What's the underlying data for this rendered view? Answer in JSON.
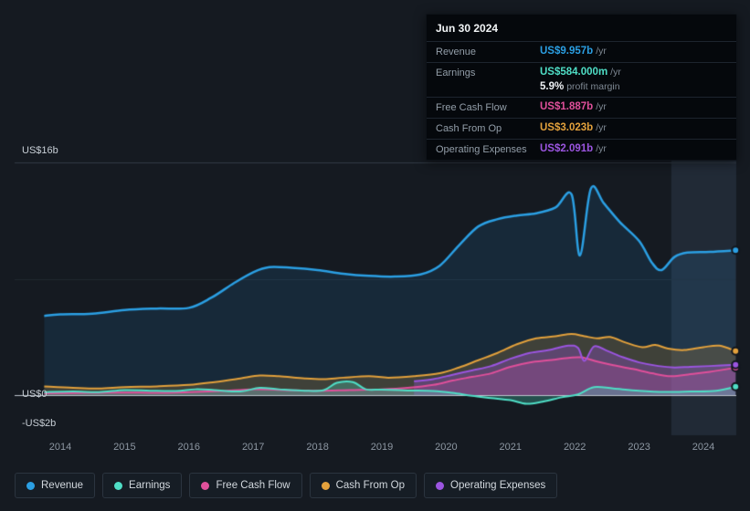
{
  "colors": {
    "background": "#151a21",
    "band": "#212a36",
    "grid": "#323b46",
    "grid_faint": "#202831",
    "zero_line": "#bcc4cd",
    "axis_text": "#8d97a2",
    "y_axis_text": "#c7ced5"
  },
  "tooltip": {
    "date": "Jun 30 2024",
    "rows": [
      {
        "id": "revenue",
        "label": "Revenue",
        "value": "US$9.957b",
        "suffix": "/yr",
        "color": "#2b9fe3"
      },
      {
        "id": "earnings",
        "label": "Earnings",
        "value": "US$584.000m",
        "suffix": "/yr",
        "color": "#4fdec6",
        "sub_value": "5.9%",
        "sub_suffix": "profit margin"
      },
      {
        "id": "free-cash-flow",
        "label": "Free Cash Flow",
        "value": "US$1.887b",
        "suffix": "/yr",
        "color": "#e0509b"
      },
      {
        "id": "cash-from-op",
        "label": "Cash From Op",
        "value": "US$3.023b",
        "suffix": "/yr",
        "color": "#e3a13c"
      },
      {
        "id": "operating-expenses",
        "label": "Operating Expenses",
        "value": "US$2.091b",
        "suffix": "/yr",
        "color": "#9b55e0"
      }
    ]
  },
  "axis": {
    "y_ticks": [
      {
        "label": "US$16b",
        "value": 16
      },
      {
        "label": "US$0",
        "value": 0
      },
      {
        "label": "-US$2b",
        "value": -2
      }
    ],
    "x_labels": [
      "2014",
      "2015",
      "2016",
      "2017",
      "2018",
      "2019",
      "2020",
      "2021",
      "2022",
      "2023",
      "2024"
    ]
  },
  "legend": [
    {
      "id": "revenue",
      "label": "Revenue",
      "color": "#2b9fe3"
    },
    {
      "id": "earnings",
      "label": "Earnings",
      "color": "#4fdec6"
    },
    {
      "id": "free-cash-flow",
      "label": "Free Cash Flow",
      "color": "#e0509b"
    },
    {
      "id": "cash-from-op",
      "label": "Cash From Op",
      "color": "#e3a13c"
    },
    {
      "id": "operating-expenses",
      "label": "Operating Expenses",
      "color": "#9b55e0"
    }
  ],
  "chart_data": {
    "type": "area",
    "unit": "US$ billions per year",
    "ylim": [
      -2,
      16
    ],
    "x_ticks": [
      2014,
      2015,
      2016,
      2017,
      2018,
      2019,
      2020,
      2021,
      2022,
      2023,
      2024
    ],
    "grid_values": [
      16,
      8
    ],
    "highlight_band": {
      "start_year": 2023.5,
      "end_year": 2024.6
    },
    "series": [
      {
        "name": "Revenue",
        "color": "#2b9fe3",
        "fill_alpha": 0.12,
        "line_width": 2.5,
        "points": [
          [
            2013.75,
            5.45
          ],
          [
            2014,
            5.55
          ],
          [
            2014.5,
            5.6
          ],
          [
            2015,
            5.85
          ],
          [
            2015.5,
            5.95
          ],
          [
            2016,
            6.0
          ],
          [
            2016.35,
            6.7
          ],
          [
            2016.7,
            7.7
          ],
          [
            2017,
            8.45
          ],
          [
            2017.25,
            8.8
          ],
          [
            2017.6,
            8.75
          ],
          [
            2018,
            8.6
          ],
          [
            2018.4,
            8.35
          ],
          [
            2018.8,
            8.2
          ],
          [
            2019.2,
            8.15
          ],
          [
            2019.6,
            8.3
          ],
          [
            2019.9,
            8.9
          ],
          [
            2020.2,
            10.3
          ],
          [
            2020.5,
            11.6
          ],
          [
            2020.8,
            12.1
          ],
          [
            2021.1,
            12.35
          ],
          [
            2021.4,
            12.5
          ],
          [
            2021.7,
            12.9
          ],
          [
            2021.95,
            13.8
          ],
          [
            2022.08,
            9.6
          ],
          [
            2022.25,
            14.2
          ],
          [
            2022.45,
            13.2
          ],
          [
            2022.7,
            11.9
          ],
          [
            2023,
            10.6
          ],
          [
            2023.2,
            9.1
          ],
          [
            2023.35,
            8.6
          ],
          [
            2023.55,
            9.5
          ],
          [
            2023.75,
            9.8
          ],
          [
            2024.1,
            9.85
          ],
          [
            2024.5,
            9.957
          ]
        ]
      },
      {
        "name": "Cash From Op",
        "color": "#e3a13c",
        "fill_alpha": 0.2,
        "line_width": 2,
        "points": [
          [
            2013.75,
            0.6
          ],
          [
            2014.2,
            0.5
          ],
          [
            2014.6,
            0.45
          ],
          [
            2015,
            0.55
          ],
          [
            2015.5,
            0.6
          ],
          [
            2016,
            0.7
          ],
          [
            2016.4,
            0.9
          ],
          [
            2016.8,
            1.15
          ],
          [
            2017.1,
            1.35
          ],
          [
            2017.4,
            1.3
          ],
          [
            2017.8,
            1.15
          ],
          [
            2018.1,
            1.1
          ],
          [
            2018.4,
            1.2
          ],
          [
            2018.8,
            1.3
          ],
          [
            2019.1,
            1.2
          ],
          [
            2019.5,
            1.3
          ],
          [
            2019.9,
            1.5
          ],
          [
            2020.2,
            1.9
          ],
          [
            2020.5,
            2.4
          ],
          [
            2020.8,
            2.9
          ],
          [
            2021.1,
            3.5
          ],
          [
            2021.4,
            3.9
          ],
          [
            2021.7,
            4.05
          ],
          [
            2021.95,
            4.2
          ],
          [
            2022.15,
            4.05
          ],
          [
            2022.35,
            3.9
          ],
          [
            2022.55,
            4.0
          ],
          [
            2022.8,
            3.6
          ],
          [
            2023.05,
            3.3
          ],
          [
            2023.25,
            3.45
          ],
          [
            2023.45,
            3.2
          ],
          [
            2023.7,
            3.1
          ],
          [
            2024,
            3.3
          ],
          [
            2024.25,
            3.4
          ],
          [
            2024.5,
            3.023
          ]
        ]
      },
      {
        "name": "Free Cash Flow",
        "color": "#e0509b",
        "fill_alpha": 0.22,
        "line_width": 2,
        "points": [
          [
            2013.75,
            0.12
          ],
          [
            2014.5,
            0.15
          ],
          [
            2015,
            0.18
          ],
          [
            2015.5,
            0.15
          ],
          [
            2016,
            0.2
          ],
          [
            2016.5,
            0.28
          ],
          [
            2017,
            0.4
          ],
          [
            2017.5,
            0.35
          ],
          [
            2018,
            0.3
          ],
          [
            2018.5,
            0.35
          ],
          [
            2019,
            0.4
          ],
          [
            2019.4,
            0.5
          ],
          [
            2019.8,
            0.7
          ],
          [
            2020.1,
            1.0
          ],
          [
            2020.4,
            1.25
          ],
          [
            2020.7,
            1.5
          ],
          [
            2021,
            1.95
          ],
          [
            2021.3,
            2.25
          ],
          [
            2021.6,
            2.4
          ],
          [
            2021.9,
            2.55
          ],
          [
            2022.1,
            2.6
          ],
          [
            2022.35,
            2.3
          ],
          [
            2022.6,
            2.05
          ],
          [
            2022.9,
            1.8
          ],
          [
            2023.2,
            1.5
          ],
          [
            2023.5,
            1.3
          ],
          [
            2023.8,
            1.45
          ],
          [
            2024.1,
            1.6
          ],
          [
            2024.5,
            1.887
          ]
        ]
      },
      {
        "name": "Operating Expenses",
        "color": "#9b55e0",
        "fill_alpha": 0.32,
        "line_width": 2,
        "points": [
          [
            2019.5,
            0.95
          ],
          [
            2019.8,
            1.1
          ],
          [
            2020.1,
            1.4
          ],
          [
            2020.4,
            1.7
          ],
          [
            2020.7,
            2.0
          ],
          [
            2021,
            2.5
          ],
          [
            2021.3,
            2.9
          ],
          [
            2021.6,
            3.1
          ],
          [
            2021.9,
            3.4
          ],
          [
            2022.05,
            3.25
          ],
          [
            2022.15,
            2.35
          ],
          [
            2022.3,
            3.35
          ],
          [
            2022.5,
            3.05
          ],
          [
            2022.75,
            2.6
          ],
          [
            2023,
            2.25
          ],
          [
            2023.3,
            2.0
          ],
          [
            2023.55,
            1.9
          ],
          [
            2023.8,
            1.95
          ],
          [
            2024.1,
            2.0
          ],
          [
            2024.5,
            2.091
          ]
        ]
      },
      {
        "name": "Earnings",
        "color": "#4fdec6",
        "fill_alpha": 0.28,
        "line_width": 2,
        "points": [
          [
            2013.75,
            0.2
          ],
          [
            2014.2,
            0.25
          ],
          [
            2014.6,
            0.2
          ],
          [
            2015,
            0.35
          ],
          [
            2015.4,
            0.3
          ],
          [
            2015.8,
            0.28
          ],
          [
            2016.1,
            0.4
          ],
          [
            2016.4,
            0.35
          ],
          [
            2016.8,
            0.25
          ],
          [
            2017.1,
            0.5
          ],
          [
            2017.4,
            0.4
          ],
          [
            2017.8,
            0.3
          ],
          [
            2018.1,
            0.35
          ],
          [
            2018.3,
            0.85
          ],
          [
            2018.55,
            0.9
          ],
          [
            2018.75,
            0.4
          ],
          [
            2019,
            0.38
          ],
          [
            2019.4,
            0.32
          ],
          [
            2019.8,
            0.28
          ],
          [
            2020.1,
            0.15
          ],
          [
            2020.4,
            -0.05
          ],
          [
            2020.7,
            -0.2
          ],
          [
            2021,
            -0.35
          ],
          [
            2021.25,
            -0.6
          ],
          [
            2021.5,
            -0.45
          ],
          [
            2021.8,
            -0.15
          ],
          [
            2022.05,
            0.05
          ],
          [
            2022.3,
            0.55
          ],
          [
            2022.6,
            0.45
          ],
          [
            2023,
            0.3
          ],
          [
            2023.4,
            0.22
          ],
          [
            2023.8,
            0.25
          ],
          [
            2024.2,
            0.3
          ],
          [
            2024.5,
            0.584
          ]
        ]
      }
    ]
  }
}
